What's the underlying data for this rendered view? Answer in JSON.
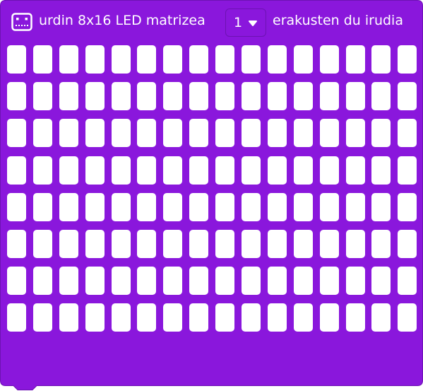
{
  "block": {
    "label_prefix": "urdin 8x16 LED matrizea",
    "selected_index": "1",
    "label_suffix": "erakusten du irudia",
    "icon": "led-matrix-icon",
    "dropdown_icon": "caret-down-icon",
    "colors": {
      "block_fill": "#8a17dc",
      "block_border": "#6d12b3",
      "led_off": "#ffffff"
    }
  },
  "matrix": {
    "rows": 8,
    "columns": 16,
    "lit_cells": []
  }
}
